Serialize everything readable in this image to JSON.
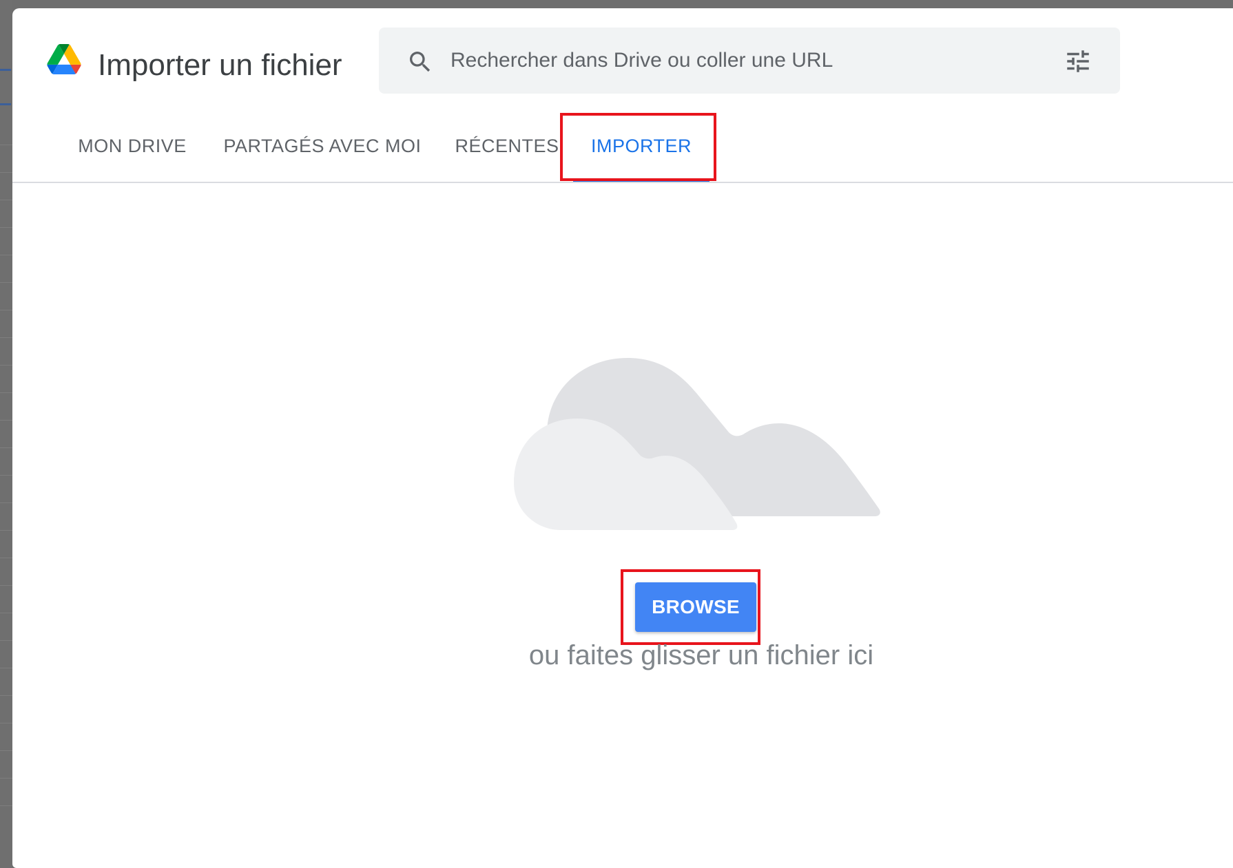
{
  "dialog": {
    "title": "Importer un fichier"
  },
  "search": {
    "placeholder": "Rechercher dans Drive ou coller une URL",
    "value": ""
  },
  "tabs": [
    {
      "label": "MON DRIVE",
      "active": false
    },
    {
      "label": "PARTAGÉS AVEC MOI",
      "active": false
    },
    {
      "label": "RÉCENTES",
      "active": false
    },
    {
      "label": "IMPORTER",
      "active": true
    }
  ],
  "upload": {
    "button_label": "BROWSE",
    "drop_hint": "ou faites glisser un fichier ici"
  },
  "icons": {
    "logo": "google-drive-logo",
    "search": "search-icon",
    "tune": "tune-icon",
    "illustration": "cloud-illustration"
  },
  "colors": {
    "accent": "#1a73e8",
    "button": "#4285f4",
    "highlight": "#e8141c",
    "search_bg": "#f1f3f4"
  }
}
